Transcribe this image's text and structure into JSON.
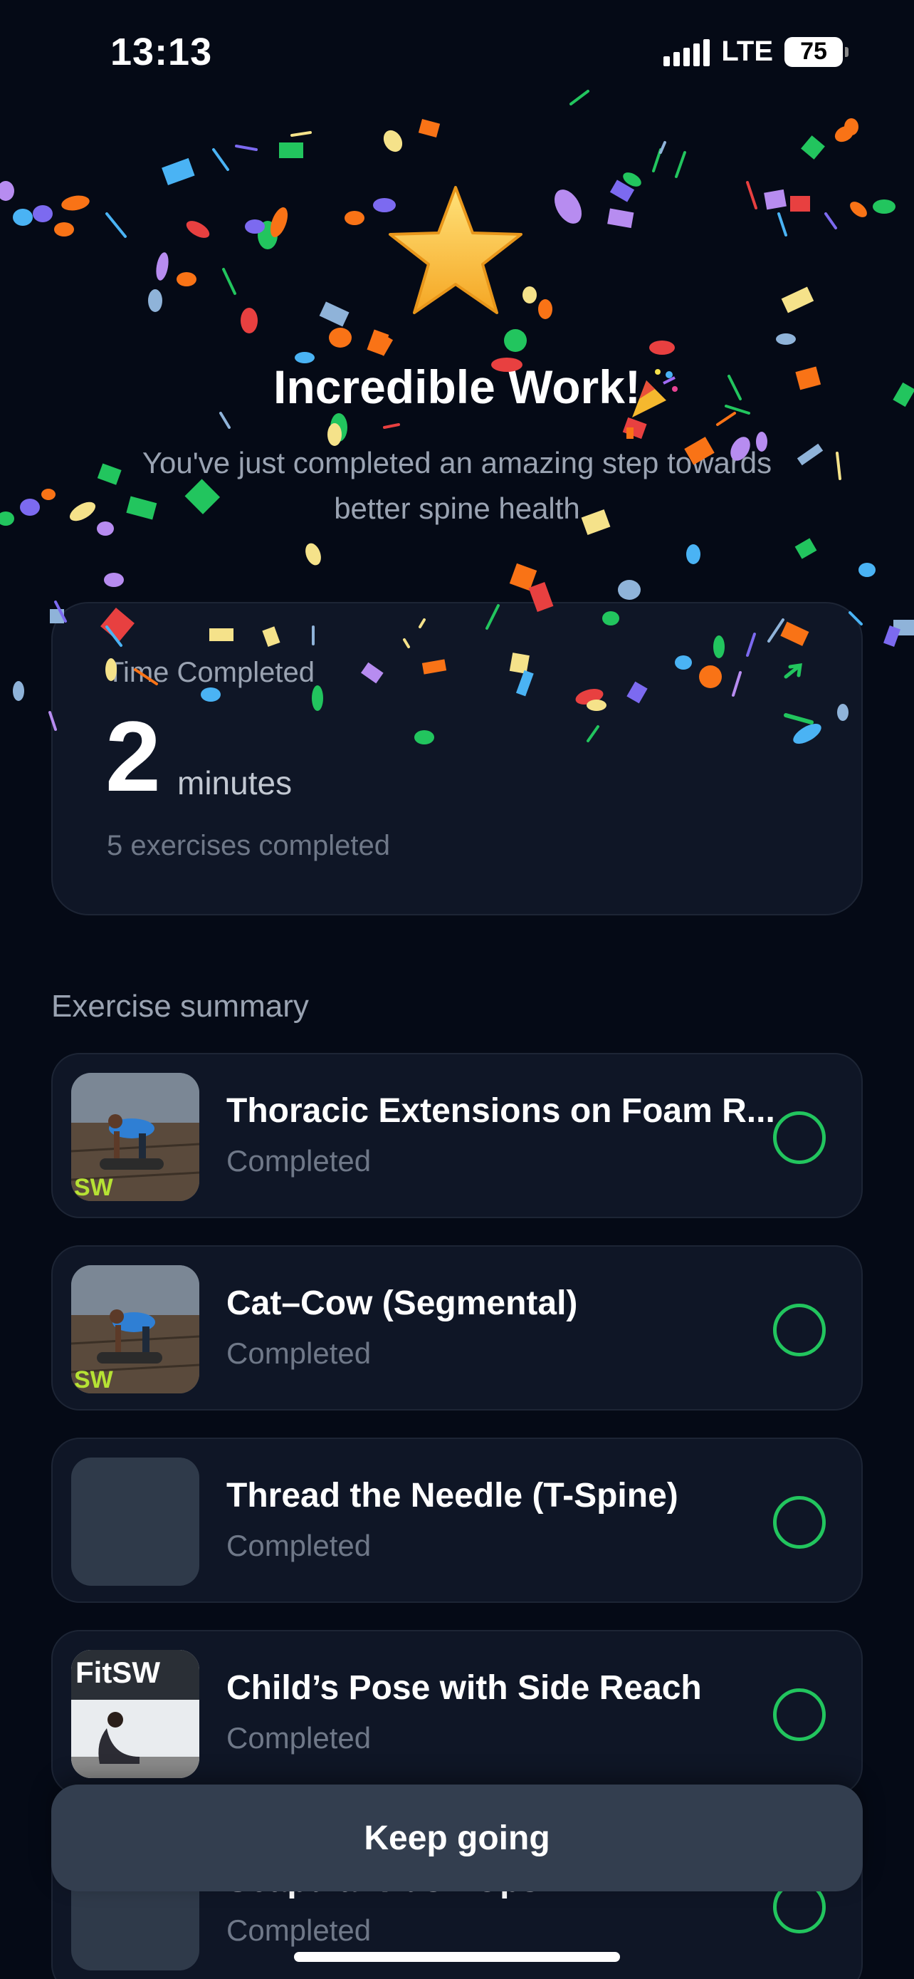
{
  "status_bar": {
    "time": "13:13",
    "network": "LTE",
    "battery": "75"
  },
  "hero": {
    "title": "Incredible Work!",
    "subtitle": "You've just completed an amazing step towards better spine health"
  },
  "time_card": {
    "label": "Time Completed",
    "value": "2",
    "unit": "minutes",
    "exercises_completed": "5 exercises completed"
  },
  "summary": {
    "title": "Exercise summary",
    "items": [
      {
        "name": "Thoracic Extensions on Foam R...",
        "status": "Completed",
        "thumb": "photo"
      },
      {
        "name": "Cat–Cow (Segmental)",
        "status": "Completed",
        "thumb": "photo"
      },
      {
        "name": "Thread the Needle (T-Spine)",
        "status": "Completed",
        "thumb": "placeholder"
      },
      {
        "name": "Child’s Pose with Side Reach",
        "status": "Completed",
        "thumb": "photo"
      },
      {
        "name": "Scapular Push-Ups",
        "status": "Completed",
        "thumb": "placeholder"
      }
    ]
  },
  "thumb_text": {
    "brand": "SW",
    "logo": "FitSW"
  },
  "cta": {
    "label": "Keep going"
  },
  "colors": {
    "background": "#050a16",
    "card": "#0f1626",
    "success": "#22c55e",
    "button": "#333e4f"
  }
}
